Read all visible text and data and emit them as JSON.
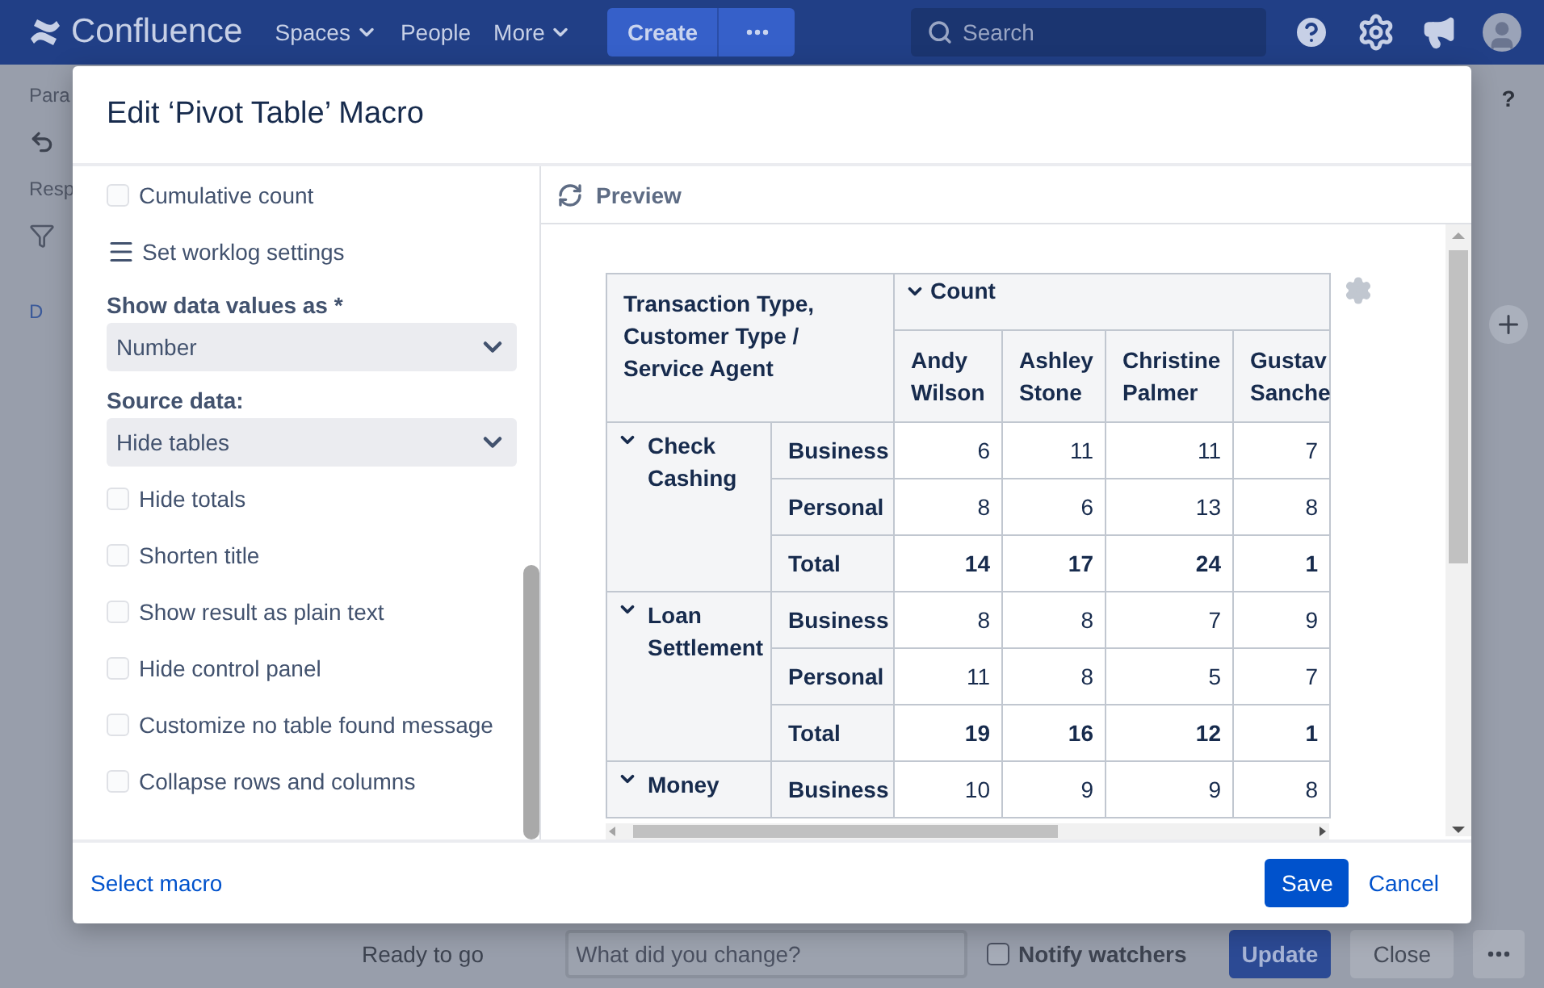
{
  "nav": {
    "logo": "Confluence",
    "items": [
      {
        "label": "Spaces",
        "dropdown": true
      },
      {
        "label": "People",
        "dropdown": false
      },
      {
        "label": "More",
        "dropdown": true
      }
    ],
    "create": "Create",
    "search": {
      "placeholder": "Search"
    }
  },
  "page_behind": {
    "breadcrumb": "Para",
    "toolbar_label": "Resp",
    "link": "D",
    "help": "?"
  },
  "dialog": {
    "title": "Edit ‘Pivot Table’ Macro",
    "options": [
      {
        "kind": "checkbox",
        "label": "Cumulative count",
        "checked": false
      },
      {
        "kind": "action",
        "label": "Set worklog settings"
      },
      {
        "kind": "select",
        "label": "Show data values as *",
        "value": "Number"
      },
      {
        "kind": "select",
        "label": "Source data:",
        "value": "Hide tables"
      },
      {
        "kind": "checkbox",
        "label": "Hide totals",
        "checked": false
      },
      {
        "kind": "checkbox",
        "label": "Shorten title",
        "checked": false
      },
      {
        "kind": "checkbox",
        "label": "Show result as plain text",
        "checked": false
      },
      {
        "kind": "checkbox",
        "label": "Hide control panel",
        "checked": false
      },
      {
        "kind": "checkbox",
        "label": "Customize no table found message",
        "checked": false
      },
      {
        "kind": "checkbox",
        "label": "Collapse rows and columns",
        "checked": false
      }
    ],
    "preview": {
      "title": "Preview",
      "table": {
        "corner": "Transaction Type, Customer Type / Service Agent",
        "measure": {
          "label": "Count",
          "expanded": true
        },
        "columns": [
          "Andy Wilson",
          "Ashley Stone",
          "Christine Palmer",
          "Gustav Sanche"
        ],
        "groups": [
          {
            "label": "Check Cashing",
            "expanded": true,
            "rows": [
              {
                "label": "Business",
                "total": false,
                "values": [
                  "6",
                  "11",
                  "11",
                  "7"
                ]
              },
              {
                "label": "Personal",
                "total": false,
                "values": [
                  "8",
                  "6",
                  "13",
                  "8"
                ]
              },
              {
                "label": "Total",
                "total": true,
                "values": [
                  "14",
                  "17",
                  "24",
                  "1"
                ]
              }
            ]
          },
          {
            "label": "Loan Settlement",
            "expanded": true,
            "rows": [
              {
                "label": "Business",
                "total": false,
                "values": [
                  "8",
                  "8",
                  "7",
                  "9"
                ]
              },
              {
                "label": "Personal",
                "total": false,
                "values": [
                  "11",
                  "8",
                  "5",
                  "7"
                ]
              },
              {
                "label": "Total",
                "total": true,
                "values": [
                  "19",
                  "16",
                  "12",
                  "1"
                ]
              }
            ]
          },
          {
            "label": "Money",
            "expanded": true,
            "rows": [
              {
                "label": "Business",
                "total": false,
                "values": [
                  "10",
                  "9",
                  "9",
                  "8"
                ]
              }
            ]
          }
        ]
      }
    },
    "footer": {
      "link": "Select macro",
      "save": "Save",
      "cancel": "Cancel"
    }
  },
  "bottom_bar": {
    "status": "Ready to go",
    "comment": {
      "placeholder": "What did you change?"
    },
    "notify": {
      "label": "Notify watchers",
      "checked": false
    },
    "update": "Update",
    "close": "Close"
  }
}
